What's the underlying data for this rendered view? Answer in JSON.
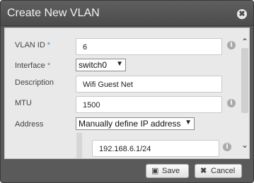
{
  "dialog": {
    "title": "Create New VLAN",
    "close_glyph": "✖"
  },
  "form": {
    "vlan_id": {
      "label": "VLAN ID",
      "required_mark": "*",
      "value": "6"
    },
    "interface": {
      "label": "Interface",
      "required_mark": "*",
      "value": "switch0"
    },
    "description": {
      "label": "Description",
      "value": "Wifi Guest Net"
    },
    "mtu": {
      "label": "MTU",
      "value": "1500"
    },
    "address": {
      "label": "Address",
      "mode": "Manually define IP address",
      "ip_value": "192.168.6.1/24"
    },
    "info_glyph": "i"
  },
  "scrollbar": {
    "up_glyph": "⌃",
    "down_glyph": "⌄"
  },
  "footer": {
    "save_label": "Save",
    "save_icon": "floppy-disk-icon",
    "cancel_label": "Cancel",
    "cancel_icon": "x-icon"
  }
}
